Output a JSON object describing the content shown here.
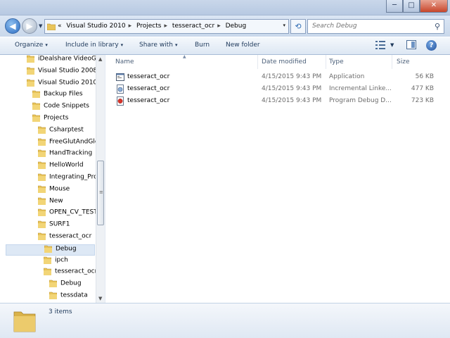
{
  "window": {
    "controls": {
      "minimize": "─",
      "maximize": "□",
      "close": "✕"
    }
  },
  "address": {
    "overflow": "«",
    "crumbs": [
      "Visual Studio 2010",
      "Projects",
      "tesseract_ocr",
      "Debug"
    ],
    "separator": "▸",
    "dropdown": "▾"
  },
  "search": {
    "placeholder": "Search Debug"
  },
  "toolbar": {
    "organize": "Organize",
    "include": "Include in library",
    "share": "Share with",
    "burn": "Burn",
    "new_folder": "New folder",
    "help": "?"
  },
  "tree": [
    {
      "label": "iDealshare VideoGo",
      "level": 0
    },
    {
      "label": "Visual Studio 2008",
      "level": 0
    },
    {
      "label": "Visual Studio 2010",
      "level": 0
    },
    {
      "label": "Backup Files",
      "level": 1
    },
    {
      "label": "Code Snippets",
      "level": 1
    },
    {
      "label": "Projects",
      "level": 1
    },
    {
      "label": "Csharptest",
      "level": 2
    },
    {
      "label": "FreeGlutAndGle",
      "level": 2
    },
    {
      "label": "HandTracking",
      "level": 2
    },
    {
      "label": "HelloWorld",
      "level": 2
    },
    {
      "label": "Integrating_Pro",
      "level": 2
    },
    {
      "label": "Mouse",
      "level": 2
    },
    {
      "label": "New",
      "level": 2
    },
    {
      "label": "OPEN_CV_TEST",
      "level": 2
    },
    {
      "label": "SURF1",
      "level": 2
    },
    {
      "label": "tesseract_ocr",
      "level": 2
    },
    {
      "label": "Debug",
      "level": 3,
      "selected": true
    },
    {
      "label": "ipch",
      "level": 3
    },
    {
      "label": "tesseract_ocr",
      "level": 3
    },
    {
      "label": "Debug",
      "level": 4
    },
    {
      "label": "tessdata",
      "level": 4
    }
  ],
  "columns": {
    "name": "Name",
    "date": "Date modified",
    "type": "Type",
    "size": "Size"
  },
  "files": [
    {
      "name": "tesseract_ocr",
      "date": "4/15/2015 9:43 PM",
      "type": "Application",
      "size": "56 KB",
      "icon": "application-icon"
    },
    {
      "name": "tesseract_ocr",
      "date": "4/15/2015 9:43 PM",
      "type": "Incremental Linke...",
      "size": "477 KB",
      "icon": "ilk-file-icon"
    },
    {
      "name": "tesseract_ocr",
      "date": "4/15/2015 9:43 PM",
      "type": "Program Debug D...",
      "size": "723 KB",
      "icon": "pdb-file-icon"
    }
  ],
  "details": {
    "count": "3 items"
  },
  "colors": {
    "folder": "#e8c45a",
    "accent": "#1e395b",
    "selection": "#dde8f5"
  }
}
